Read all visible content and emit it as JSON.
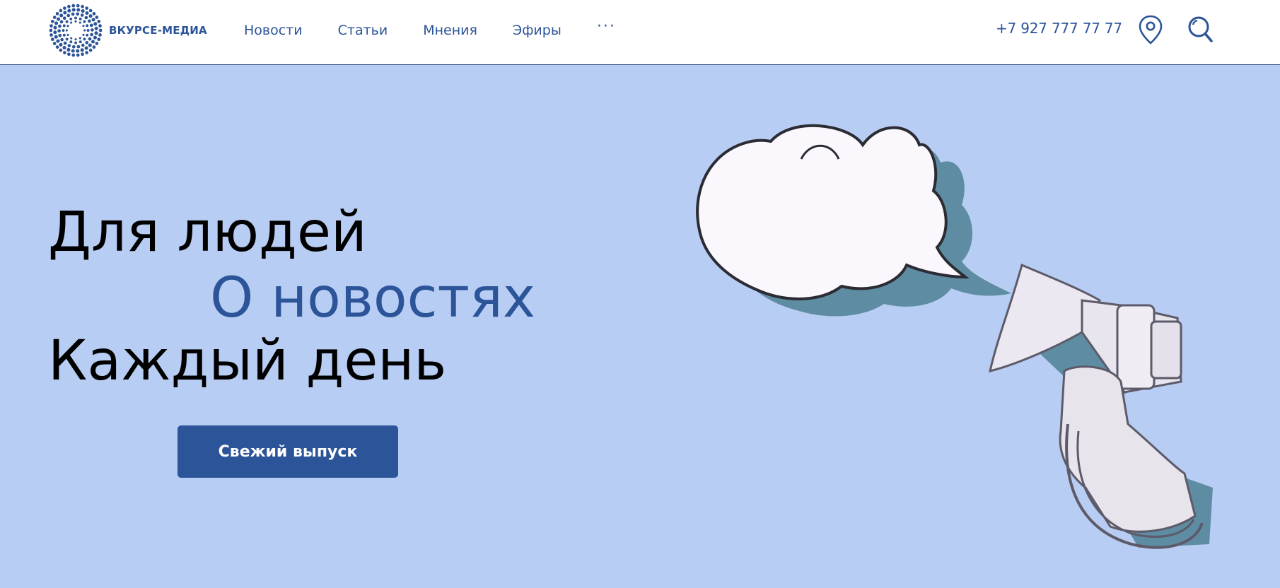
{
  "header": {
    "logo": {
      "text": "ВКУРСЕ-МЕДИА",
      "icon": "dotted-circle-logo-icon"
    },
    "nav": [
      {
        "label": "Новости"
      },
      {
        "label": "Статьи"
      },
      {
        "label": "Мнения"
      },
      {
        "label": "Эфиры"
      }
    ],
    "more_label": "···",
    "phone": "+7 927 777 77 77",
    "location_icon": "map-pin-icon",
    "search_icon": "search-icon"
  },
  "hero": {
    "line1": "Для людей",
    "line2": "О новостях",
    "line3": "Каждый день",
    "cta_label": "Свежий выпуск"
  },
  "illustration": {
    "icon": "megaphone-speech-bubble-illustration"
  },
  "colors": {
    "accent": "#2c5498",
    "hero_bg": "#b8cdf3",
    "header_bg": "#ffffff",
    "shadow": "#5e8da3"
  }
}
